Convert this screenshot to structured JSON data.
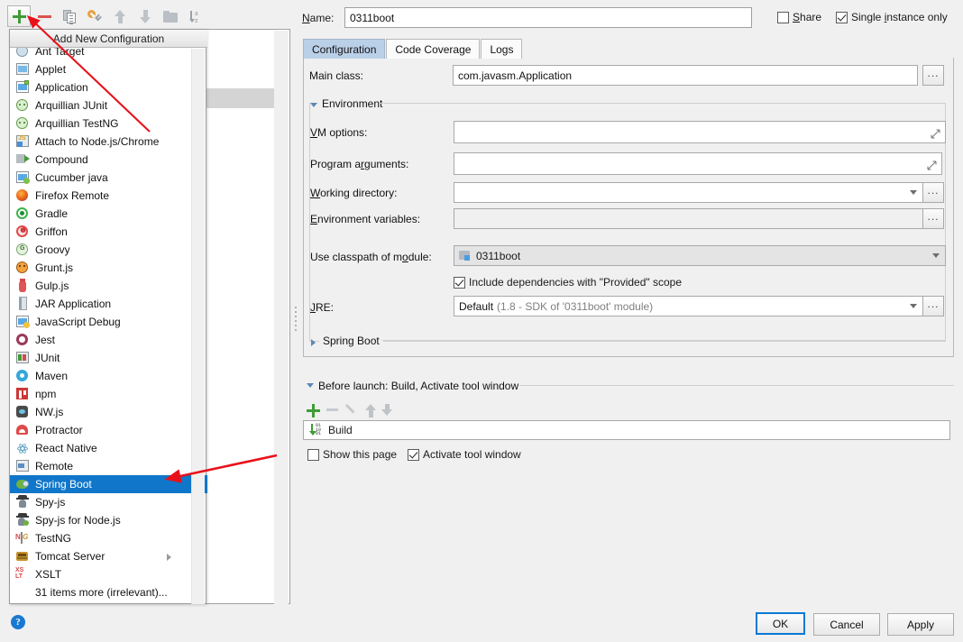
{
  "toolbar": {
    "buttons": [
      {
        "name": "add-configuration-button",
        "icon": "plus-icon",
        "tooltip": "Add New Configuration"
      },
      {
        "name": "remove-configuration-button",
        "icon": "minus-icon"
      },
      {
        "name": "copy-configuration-button",
        "icon": "copy-icon"
      },
      {
        "name": "edit-templates-button",
        "icon": "wrench-icon"
      },
      {
        "name": "move-up-button",
        "icon": "arrow-up-icon"
      },
      {
        "name": "move-down-button",
        "icon": "arrow-down-icon"
      },
      {
        "name": "new-folder-button",
        "icon": "folder-icon"
      },
      {
        "name": "sort-configurations-button",
        "icon": "sort-az-icon"
      }
    ]
  },
  "add_menu": {
    "title": "Add New Configuration",
    "items": [
      {
        "label": "Ant Target",
        "icon": "ant-icon"
      },
      {
        "label": "Applet",
        "icon": "applet-icon"
      },
      {
        "label": "Application",
        "icon": "application-icon"
      },
      {
        "label": "Arquillian JUnit",
        "icon": "arquillian-icon"
      },
      {
        "label": "Arquillian TestNG",
        "icon": "arquillian-icon"
      },
      {
        "label": "Attach to Node.js/Chrome",
        "icon": "nodejs-attach-icon"
      },
      {
        "label": "Compound",
        "icon": "compound-icon"
      },
      {
        "label": "Cucumber java",
        "icon": "cucumber-icon"
      },
      {
        "label": "Firefox Remote",
        "icon": "firefox-icon"
      },
      {
        "label": "Gradle",
        "icon": "gradle-icon"
      },
      {
        "label": "Griffon",
        "icon": "griffon-icon"
      },
      {
        "label": "Groovy",
        "icon": "groovy-icon"
      },
      {
        "label": "Grunt.js",
        "icon": "grunt-icon"
      },
      {
        "label": "Gulp.js",
        "icon": "gulp-icon"
      },
      {
        "label": "JAR Application",
        "icon": "jar-icon"
      },
      {
        "label": "JavaScript Debug",
        "icon": "javascript-debug-icon"
      },
      {
        "label": "Jest",
        "icon": "jest-icon"
      },
      {
        "label": "JUnit",
        "icon": "junit-icon"
      },
      {
        "label": "Maven",
        "icon": "maven-icon"
      },
      {
        "label": "npm",
        "icon": "npm-icon"
      },
      {
        "label": "NW.js",
        "icon": "nwjs-icon"
      },
      {
        "label": "Protractor",
        "icon": "protractor-icon"
      },
      {
        "label": "React Native",
        "icon": "react-icon"
      },
      {
        "label": "Remote",
        "icon": "remote-icon"
      },
      {
        "label": "Spring Boot",
        "icon": "spring-boot-icon",
        "selected": true
      },
      {
        "label": "Spy-js",
        "icon": "spyjs-icon"
      },
      {
        "label": "Spy-js for Node.js",
        "icon": "spyjs-node-icon"
      },
      {
        "label": "TestNG",
        "icon": "testng-icon"
      },
      {
        "label": "Tomcat Server",
        "icon": "tomcat-icon",
        "submenu": true
      },
      {
        "label": "XSLT",
        "icon": "xslt-icon"
      },
      {
        "label": "31 items more (irrelevant)...",
        "icon": "none"
      }
    ]
  },
  "form": {
    "name_label": "Name:",
    "name_value": "0311boot",
    "share_label": "Share",
    "share_checked": false,
    "single_instance_label": "Single instance only",
    "single_instance_checked": true,
    "tabs": [
      {
        "label": "Configuration",
        "active": true
      },
      {
        "label": "Code Coverage",
        "active": false
      },
      {
        "label": "Logs",
        "active": false
      }
    ],
    "main_class_label": "Main class:",
    "main_class_value": "com.javasm.Application",
    "environment_section": "Environment",
    "vm_options_label": "VM options:",
    "vm_options_value": "",
    "program_arguments_label": "Program arguments:",
    "program_arguments_value": "",
    "working_directory_label": "Working directory:",
    "working_directory_value": "",
    "environment_variables_label": "Environment variables:",
    "environment_variables_value": "",
    "use_classpath_label": "Use classpath of module:",
    "use_classpath_value": "0311boot",
    "include_dependencies_label": "Include dependencies with \"Provided\" scope",
    "include_dependencies_checked": true,
    "jre_label": "JRE:",
    "jre_value": "Default",
    "jre_value_muted": "(1.8 - SDK of '0311boot' module)",
    "spring_boot_section": "Spring Boot",
    "browse_button_label": "..."
  },
  "before_launch": {
    "title": "Before launch: Build, Activate tool window",
    "toolbar": [
      {
        "name": "add-task-button",
        "icon": "plus-icon"
      },
      {
        "name": "remove-task-button",
        "icon": "minus-icon"
      },
      {
        "name": "edit-task-button",
        "icon": "pencil-icon"
      },
      {
        "name": "move-task-up-button",
        "icon": "arrow-up-icon"
      },
      {
        "name": "move-task-down-button",
        "icon": "arrow-down-icon"
      }
    ],
    "tasks": [
      {
        "label": "Build",
        "icon": "build-icon"
      }
    ],
    "show_page_label": "Show this page",
    "show_page_checked": false,
    "activate_tool_window_label": "Activate tool window",
    "activate_tool_window_checked": true
  },
  "footer": {
    "ok_label": "OK",
    "cancel_label": "Cancel",
    "apply_label": "Apply",
    "help_label": "?"
  },
  "colors": {
    "selection_blue": "#1076c9",
    "tab_active": "#bacfe8",
    "accent_green": "#3f9c35",
    "annotation_red": "#e8111a",
    "dialog_bg": "#f0f0f0"
  }
}
